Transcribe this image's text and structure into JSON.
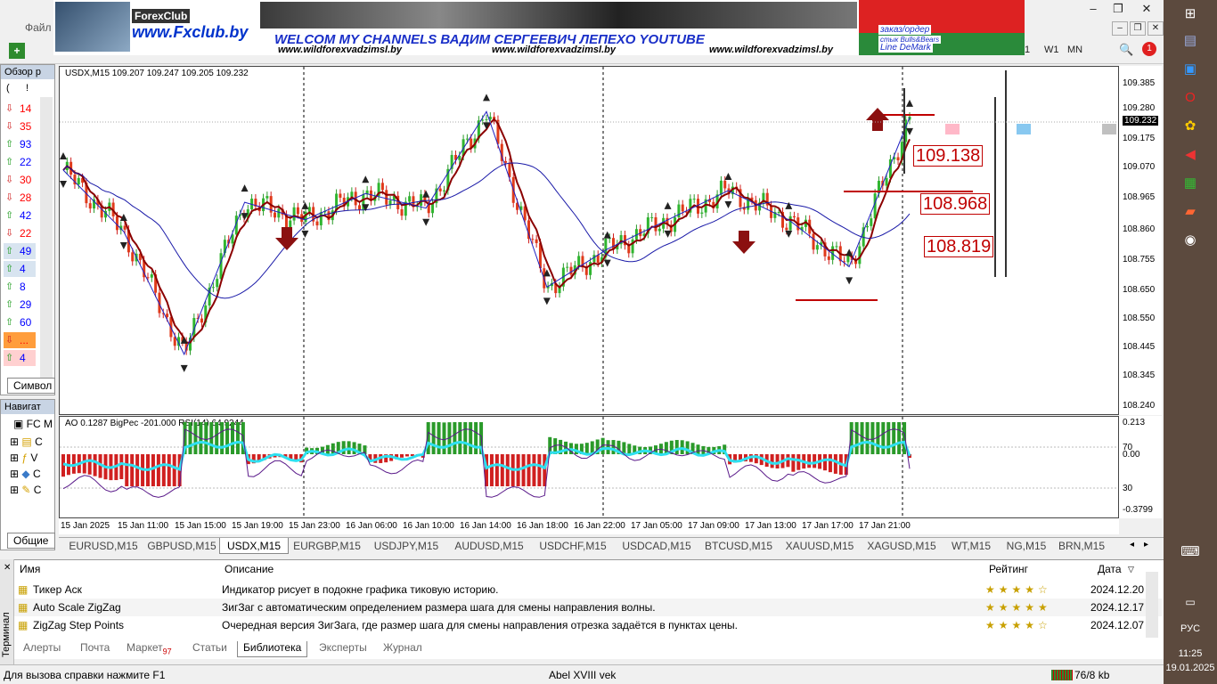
{
  "menu": {
    "file": "Файл"
  },
  "banner": {
    "forex_logo": "ForexClub",
    "site": "www.Fxclub.by",
    "welcome": "WELCOM MY CHANNELS ВАДИМ СЕРГЕЕВИЧ ЛЕПЕХО YOUTUBE",
    "url": "www.wildforexvadzimsl.by",
    "tag1": "заказ/ордер",
    "tag2": "стык Bulls&Bears",
    "tag3": "Line DeMark"
  },
  "timeframes": [
    "1",
    "W1",
    "MN"
  ],
  "notif_count": "1",
  "market_watch": {
    "title": "Обзор р",
    "header": [
      "(",
      "!"
    ],
    "rows": [
      {
        "dir": "down",
        "value": "14",
        "color": "#ff0000"
      },
      {
        "dir": "down",
        "value": "35",
        "color": "#ff0000"
      },
      {
        "dir": "up",
        "value": "93",
        "color": "#0000ff"
      },
      {
        "dir": "up",
        "value": "22",
        "color": "#0000ff"
      },
      {
        "dir": "down",
        "value": "30",
        "color": "#ff0000"
      },
      {
        "dir": "down",
        "value": "28",
        "color": "#ff0000"
      },
      {
        "dir": "up",
        "value": "42",
        "color": "#0000ff"
      },
      {
        "dir": "down",
        "value": "22",
        "color": "#ff0000"
      },
      {
        "dir": "up",
        "value": "49",
        "color": "#0000ff"
      },
      {
        "dir": "up",
        "value": "4",
        "color": "#0000ff"
      },
      {
        "dir": "up",
        "value": "8",
        "color": "#0000ff"
      },
      {
        "dir": "up",
        "value": "29",
        "color": "#0000ff"
      },
      {
        "dir": "up",
        "value": "60",
        "color": "#0000ff"
      },
      {
        "dir": "down",
        "value": "...",
        "color": "#ff0000"
      },
      {
        "dir": "up",
        "value": "4",
        "color": "#0000ff"
      }
    ],
    "tab": "Символ"
  },
  "navigator": {
    "title": "Навигат",
    "root": "FC M",
    "items": [
      "C",
      "V",
      "C",
      "C"
    ],
    "tab": "Общие"
  },
  "chart": {
    "header": "USDX,M15  109.207 109.247 109.205 109.232",
    "price_ticks": [
      "109.385",
      "109.280",
      "109.232",
      "109.175",
      "109.070",
      "108.965",
      "108.860",
      "108.755",
      "108.650",
      "108.550",
      "108.445",
      "108.345",
      "108.240"
    ],
    "current_price": "109.232",
    "levels": [
      "109.138",
      "108.968",
      "108.819"
    ],
    "indicator_header": "AO 0.1287  BigPec -201.000  RSI(14) 64.9244",
    "ind_ticks": [
      "0.213",
      "70",
      "0.00",
      "30",
      "-0.3799"
    ],
    "time_ticks": [
      "15 Jan 2025",
      "15 Jan 11:00",
      "15 Jan 15:00",
      "15 Jan 19:00",
      "15 Jan 23:00",
      "16 Jan 06:00",
      "16 Jan 10:00",
      "16 Jan 14:00",
      "16 Jan 18:00",
      "16 Jan 22:00",
      "17 Jan 05:00",
      "17 Jan 09:00",
      "17 Jan 13:00",
      "17 Jan 17:00",
      "17 Jan 21:00"
    ]
  },
  "chart_data": {
    "type": "line",
    "title": "USDX,M15",
    "x": [
      "15 Jan 2025",
      "15 Jan 11:00",
      "15 Jan 15:00",
      "15 Jan 19:00",
      "15 Jan 23:00",
      "16 Jan 06:00",
      "16 Jan 10:00",
      "16 Jan 14:00",
      "16 Jan 18:00",
      "16 Jan 22:00",
      "17 Jan 05:00",
      "17 Jan 09:00",
      "17 Jan 13:00",
      "17 Jan 17:00",
      "17 Jan 21:00"
    ],
    "series": [
      {
        "values": [
          109.05,
          108.84,
          108.42,
          108.94,
          108.88,
          108.97,
          108.92,
          109.25,
          108.65,
          108.78,
          108.88,
          108.98,
          108.88,
          108.72,
          109.23
        ]
      }
    ],
    "ylim": [
      108.24,
      109.385
    ],
    "xlabel": "",
    "ylabel": ""
  },
  "symbol_tabs": [
    "EURUSD,M15",
    "GBPUSD,M15",
    "USDX,M15",
    "EURGBP,M15",
    "USDJPY,M15",
    "AUDUSD,M15",
    "USDCHF,M15",
    "USDCAD,M15",
    "BTCUSD,M15",
    "XAUUSD,M15",
    "XAGUSD,M15",
    "WT,M15",
    "NG,M15",
    "BRN,M15"
  ],
  "active_symbol_tab": "USDX,M15",
  "terminal": {
    "side_label": "Терминал",
    "columns": {
      "name": "Имя",
      "desc": "Описание",
      "rating": "Рейтинг",
      "date": "Дата"
    },
    "rows": [
      {
        "name": "Тикер Аск",
        "desc": "Индикатор рисует в подокне графика тиковую историю.",
        "stars": 4,
        "date": "2024.12.20"
      },
      {
        "name": "Auto Scale ZigZag",
        "desc": "ЗигЗаг с автоматическим определением размера шага для смены направления волны.",
        "stars": 5,
        "date": "2024.12.17"
      },
      {
        "name": "ZigZag Step Points",
        "desc": "Очередная версия ЗигЗага, где размер шага для смены направления отрезка задаётся в пунктах цены.",
        "stars": 4,
        "date": "2024.12.07"
      }
    ],
    "tabs": [
      {
        "label": "Алерты"
      },
      {
        "label": "Почта"
      },
      {
        "label": "Маркет",
        "badge": "97"
      },
      {
        "label": "Статьи"
      },
      {
        "label": "Библиотека",
        "active": true
      },
      {
        "label": "Эксперты"
      },
      {
        "label": "Журнал"
      }
    ]
  },
  "status": {
    "help": "Для вызова справки нажмите F1",
    "profile": "Abel XVIII vek",
    "traffic": "76/8 kb"
  },
  "taskbar": {
    "lang": "РУС",
    "time": "11:25",
    "date": "19.01.2025"
  }
}
